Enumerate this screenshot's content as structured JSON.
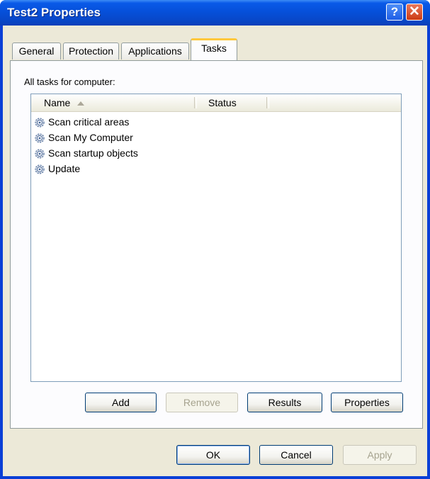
{
  "window": {
    "title": "Test2 Properties",
    "help_glyph": "?",
    "close_glyph": "✕"
  },
  "tabs": [
    {
      "label": "General"
    },
    {
      "label": "Protection"
    },
    {
      "label": "Applications"
    },
    {
      "label": "Tasks",
      "active": true
    }
  ],
  "tasks_panel": {
    "caption": "All tasks for computer:",
    "columns": [
      {
        "label": "Name",
        "sorted": "ascending"
      },
      {
        "label": "Status"
      }
    ],
    "rows": [
      {
        "name": "Scan critical areas",
        "icon": "task-gear-icon"
      },
      {
        "name": "Scan My Computer",
        "icon": "task-gear-icon"
      },
      {
        "name": "Scan startup objects",
        "icon": "task-gear-icon"
      },
      {
        "name": "Update",
        "icon": "task-gear-icon"
      }
    ],
    "buttons": {
      "add": "Add",
      "remove": "Remove",
      "results": "Results",
      "properties": "Properties"
    }
  },
  "dialog_buttons": {
    "ok": "OK",
    "cancel": "Cancel",
    "apply": "Apply"
  }
}
